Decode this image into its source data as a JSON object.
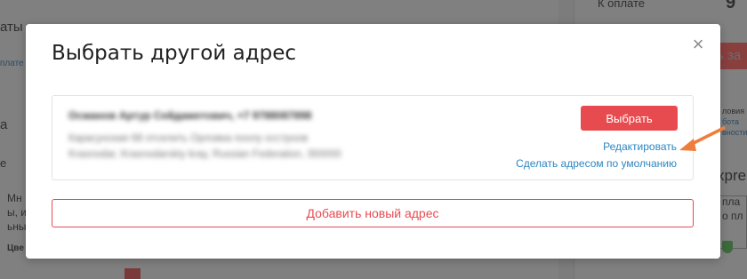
{
  "background": {
    "right_top_label": "К оплате",
    "right_top_value": "9",
    "left_fragments": [
      "аты",
      "плате",
      "а",
      "е",
      "Мн",
      "ы, и",
      "ьны",
      "Цве"
    ],
    "right_fragments": [
      "ловия",
      "бота",
      "вности",
      "xpre",
      "пла",
      "о пл"
    ],
    "button_fragment": "ь за"
  },
  "modal": {
    "title": "Выбрать другой адрес",
    "close_icon": "×",
    "address": {
      "name": "Османов Артур Сейдаметович, +7 9788087898",
      "line1": "Карасунская 68 отселить Орловка поолу осстроов",
      "line2": "Krasnodar, Krasnodarskiy kray, Russian Federation, 350000"
    },
    "select_label": "Выбрать",
    "edit_label": "Редактировать",
    "default_label": "Сделать адресом по умолчанию",
    "add_label": "Добавить новый адрес"
  },
  "colors": {
    "accent_red": "#e84b4f",
    "link_blue": "#2d86c2",
    "arrow_orange": "#ef7d3c"
  }
}
